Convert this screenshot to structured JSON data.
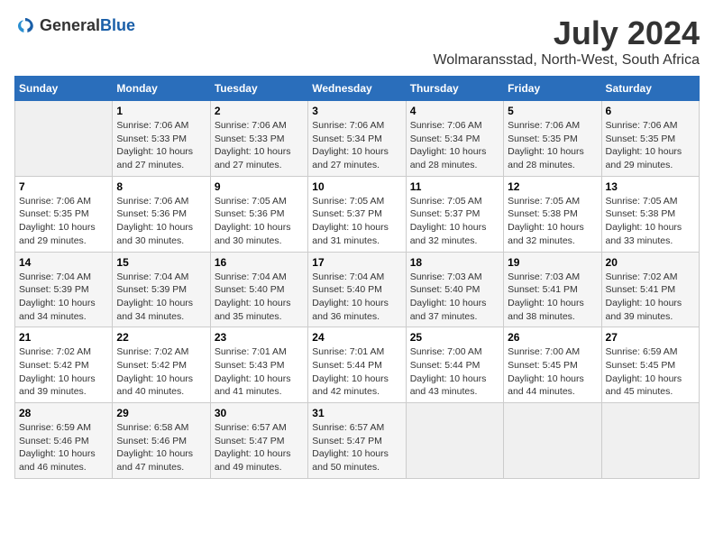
{
  "logo": {
    "general": "General",
    "blue": "Blue"
  },
  "title": "July 2024",
  "subtitle": "Wolmaransstad, North-West, South Africa",
  "days_header": [
    "Sunday",
    "Monday",
    "Tuesday",
    "Wednesday",
    "Thursday",
    "Friday",
    "Saturday"
  ],
  "weeks": [
    [
      {
        "day": "",
        "detail": ""
      },
      {
        "day": "1",
        "detail": "Sunrise: 7:06 AM\nSunset: 5:33 PM\nDaylight: 10 hours\nand 27 minutes."
      },
      {
        "day": "2",
        "detail": "Sunrise: 7:06 AM\nSunset: 5:33 PM\nDaylight: 10 hours\nand 27 minutes."
      },
      {
        "day": "3",
        "detail": "Sunrise: 7:06 AM\nSunset: 5:34 PM\nDaylight: 10 hours\nand 27 minutes."
      },
      {
        "day": "4",
        "detail": "Sunrise: 7:06 AM\nSunset: 5:34 PM\nDaylight: 10 hours\nand 28 minutes."
      },
      {
        "day": "5",
        "detail": "Sunrise: 7:06 AM\nSunset: 5:35 PM\nDaylight: 10 hours\nand 28 minutes."
      },
      {
        "day": "6",
        "detail": "Sunrise: 7:06 AM\nSunset: 5:35 PM\nDaylight: 10 hours\nand 29 minutes."
      }
    ],
    [
      {
        "day": "7",
        "detail": "Sunrise: 7:06 AM\nSunset: 5:35 PM\nDaylight: 10 hours\nand 29 minutes."
      },
      {
        "day": "8",
        "detail": "Sunrise: 7:06 AM\nSunset: 5:36 PM\nDaylight: 10 hours\nand 30 minutes."
      },
      {
        "day": "9",
        "detail": "Sunrise: 7:05 AM\nSunset: 5:36 PM\nDaylight: 10 hours\nand 30 minutes."
      },
      {
        "day": "10",
        "detail": "Sunrise: 7:05 AM\nSunset: 5:37 PM\nDaylight: 10 hours\nand 31 minutes."
      },
      {
        "day": "11",
        "detail": "Sunrise: 7:05 AM\nSunset: 5:37 PM\nDaylight: 10 hours\nand 32 minutes."
      },
      {
        "day": "12",
        "detail": "Sunrise: 7:05 AM\nSunset: 5:38 PM\nDaylight: 10 hours\nand 32 minutes."
      },
      {
        "day": "13",
        "detail": "Sunrise: 7:05 AM\nSunset: 5:38 PM\nDaylight: 10 hours\nand 33 minutes."
      }
    ],
    [
      {
        "day": "14",
        "detail": "Sunrise: 7:04 AM\nSunset: 5:39 PM\nDaylight: 10 hours\nand 34 minutes."
      },
      {
        "day": "15",
        "detail": "Sunrise: 7:04 AM\nSunset: 5:39 PM\nDaylight: 10 hours\nand 34 minutes."
      },
      {
        "day": "16",
        "detail": "Sunrise: 7:04 AM\nSunset: 5:40 PM\nDaylight: 10 hours\nand 35 minutes."
      },
      {
        "day": "17",
        "detail": "Sunrise: 7:04 AM\nSunset: 5:40 PM\nDaylight: 10 hours\nand 36 minutes."
      },
      {
        "day": "18",
        "detail": "Sunrise: 7:03 AM\nSunset: 5:40 PM\nDaylight: 10 hours\nand 37 minutes."
      },
      {
        "day": "19",
        "detail": "Sunrise: 7:03 AM\nSunset: 5:41 PM\nDaylight: 10 hours\nand 38 minutes."
      },
      {
        "day": "20",
        "detail": "Sunrise: 7:02 AM\nSunset: 5:41 PM\nDaylight: 10 hours\nand 39 minutes."
      }
    ],
    [
      {
        "day": "21",
        "detail": "Sunrise: 7:02 AM\nSunset: 5:42 PM\nDaylight: 10 hours\nand 39 minutes."
      },
      {
        "day": "22",
        "detail": "Sunrise: 7:02 AM\nSunset: 5:42 PM\nDaylight: 10 hours\nand 40 minutes."
      },
      {
        "day": "23",
        "detail": "Sunrise: 7:01 AM\nSunset: 5:43 PM\nDaylight: 10 hours\nand 41 minutes."
      },
      {
        "day": "24",
        "detail": "Sunrise: 7:01 AM\nSunset: 5:44 PM\nDaylight: 10 hours\nand 42 minutes."
      },
      {
        "day": "25",
        "detail": "Sunrise: 7:00 AM\nSunset: 5:44 PM\nDaylight: 10 hours\nand 43 minutes."
      },
      {
        "day": "26",
        "detail": "Sunrise: 7:00 AM\nSunset: 5:45 PM\nDaylight: 10 hours\nand 44 minutes."
      },
      {
        "day": "27",
        "detail": "Sunrise: 6:59 AM\nSunset: 5:45 PM\nDaylight: 10 hours\nand 45 minutes."
      }
    ],
    [
      {
        "day": "28",
        "detail": "Sunrise: 6:59 AM\nSunset: 5:46 PM\nDaylight: 10 hours\nand 46 minutes."
      },
      {
        "day": "29",
        "detail": "Sunrise: 6:58 AM\nSunset: 5:46 PM\nDaylight: 10 hours\nand 47 minutes."
      },
      {
        "day": "30",
        "detail": "Sunrise: 6:57 AM\nSunset: 5:47 PM\nDaylight: 10 hours\nand 49 minutes."
      },
      {
        "day": "31",
        "detail": "Sunrise: 6:57 AM\nSunset: 5:47 PM\nDaylight: 10 hours\nand 50 minutes."
      },
      {
        "day": "",
        "detail": ""
      },
      {
        "day": "",
        "detail": ""
      },
      {
        "day": "",
        "detail": ""
      }
    ]
  ]
}
